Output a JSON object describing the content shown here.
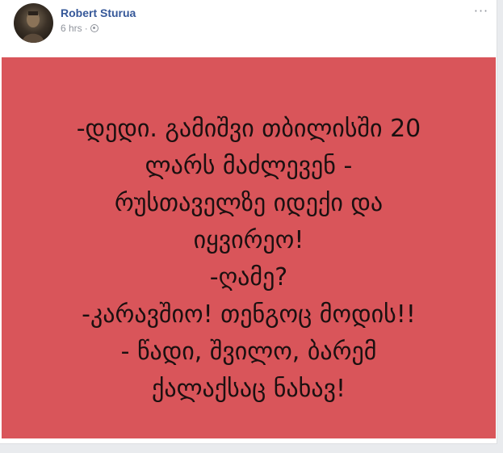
{
  "post": {
    "author": "Robert Sturua",
    "time": "6 hrs",
    "separator": "·",
    "more_label": "···",
    "image_bg_color": "#d9555a",
    "image_text_color": "#1b1010",
    "image_text_lines": [
      "-დედი. გამიშვი თბილისში 20",
      "ლარს მაძლევენ -",
      "რუსთაველზე იდექი და",
      "იყვირეო!",
      "-ღამე?",
      "-კარავშიო! თენგოც მოდის!!",
      "- წადი, შვილო, ბარემ",
      "ქალაქსაც ნახავ!"
    ]
  },
  "icons": {
    "avatar": "profile-photo",
    "privacy": "globe-icon",
    "menu": "more-icon"
  },
  "colors": {
    "author_link": "#365899",
    "meta_text": "#90949c",
    "page_bg": "#e9ebee"
  }
}
